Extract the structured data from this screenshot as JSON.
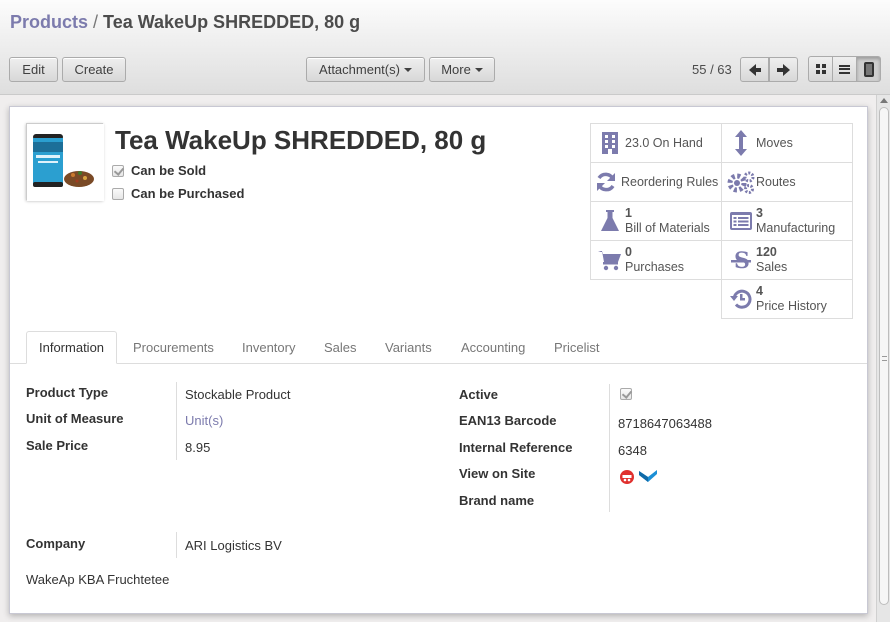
{
  "breadcrumb": {
    "parent": "Products",
    "separator": "/",
    "current": "Tea WakeUp SHREDDED, 80 g"
  },
  "toolbar": {
    "edit": "Edit",
    "create": "Create",
    "attachments": "Attachment(s)",
    "more": "More"
  },
  "pager": {
    "value": "55 / 63"
  },
  "product": {
    "name": "Tea WakeUp SHREDDED, 80 g",
    "can_be_sold": {
      "label": "Can be Sold",
      "checked": true
    },
    "can_be_purchased": {
      "label": "Can be Purchased",
      "checked": false
    }
  },
  "smart_buttons": {
    "on_hand": "23.0 On Hand",
    "moves": "Moves",
    "reordering_rules": "Reordering Rules",
    "routes": "Routes",
    "bom_count": "1",
    "bom_label": "Bill of Materials",
    "manufacturing_count": "3",
    "manufacturing_label": "Manufacturing",
    "purchases_count": "0",
    "purchases_label": "Purchases",
    "sales_count": "120",
    "sales_label": "Sales",
    "price_history_count": "4",
    "price_history_label": "Price History"
  },
  "tabs": [
    "Information",
    "Procurements",
    "Inventory",
    "Sales",
    "Variants",
    "Accounting",
    "Pricelist"
  ],
  "information": {
    "product_type_label": "Product Type",
    "product_type": "Stockable Product",
    "uom_label": "Unit of Measure",
    "uom": "Unit(s)",
    "sale_price_label": "Sale Price",
    "sale_price": "8.95",
    "active_label": "Active",
    "active": true,
    "ean13_label": "EAN13 Barcode",
    "ean13": "8718647063488",
    "internal_ref_label": "Internal Reference",
    "internal_ref": "6348",
    "view_on_site_label": "View on Site",
    "brand_label": "Brand name",
    "company_label": "Company",
    "company": "ARI Logistics BV",
    "description": "WakeAp KBA Fruchtetee"
  },
  "colors": {
    "accent": "#7c7bad",
    "header_top": "#fcfcfc",
    "header_bottom": "#dedede",
    "sheet_border": "#c8c8d3"
  }
}
